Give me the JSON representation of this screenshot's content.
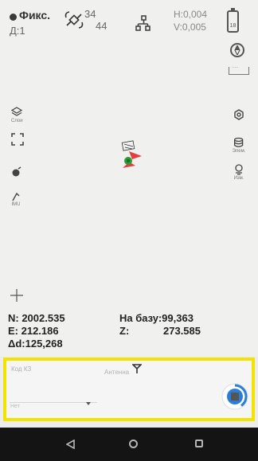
{
  "status": {
    "fix": "Фикс.",
    "diff_age": "Д:1",
    "satellites_used": "34",
    "satellites_visible": "44",
    "h_accuracy": "H:0,004",
    "v_accuracy": "V:0,005",
    "battery": "18"
  },
  "left_tools": [
    {
      "icon": "layers-icon",
      "label": "Слои"
    },
    {
      "icon": "fullscreen-icon",
      "label": ""
    },
    {
      "icon": "locate-icon",
      "label": ""
    },
    {
      "icon": "tilt-icon",
      "label": "IMU"
    }
  ],
  "right_tools": [
    {
      "icon": "settings-icon",
      "label": ""
    },
    {
      "icon": "elements-icon",
      "label": "Элем."
    },
    {
      "icon": "measure-icon",
      "label": "Изм."
    }
  ],
  "coords": {
    "n": "N: 2002.535",
    "e": "E: 212.186",
    "delta_d": "Δd:125,268",
    "to_base_label": "На базу:99,363",
    "z_label": "Z:",
    "z_value": "273.585"
  },
  "panel": {
    "code_label": "Код КЗ",
    "antenna_label": "Антенна",
    "small_label": "Нет"
  },
  "colors": {
    "highlight": "#f2e400",
    "accent": "#2a7fd4",
    "marker_red": "#e02020",
    "marker_green": "#2e9a3a"
  }
}
